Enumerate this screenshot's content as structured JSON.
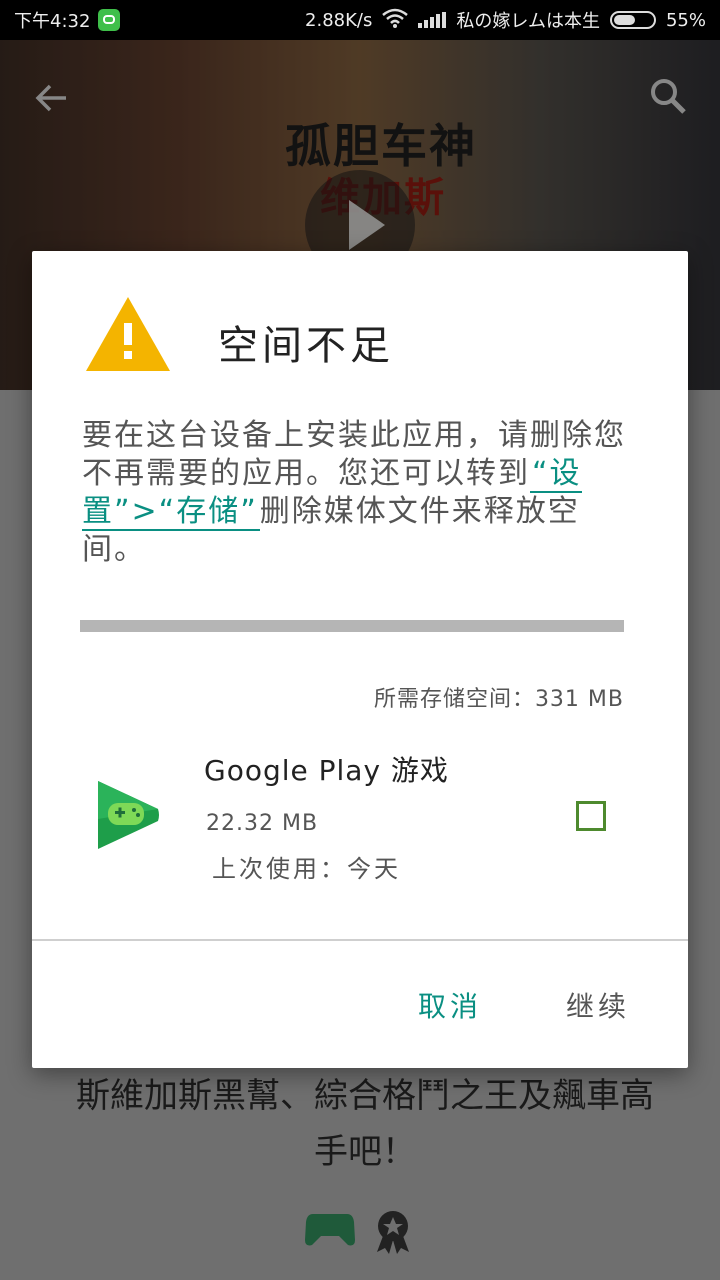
{
  "status_bar": {
    "time": "下午4:32",
    "network_speed": "2.88K/s",
    "carrier": "私の嫁レムは本生",
    "battery": "55%",
    "battery_level": 0.55
  },
  "background": {
    "title_line1": "孤胆车神",
    "title_line2": "维加斯",
    "description": "斯維加斯黑幫、綜合格鬥之王及飆車高手吧！"
  },
  "dialog": {
    "title": "空间不足",
    "message_before": "要在这台设备上安装此应用，请删除您不再需要的应用。您还可以转到",
    "message_link": "“设置”>“存储”",
    "message_after": "删除媒体文件来释放空间。",
    "required_space": "所需存储空间：331 MB",
    "app": {
      "name": "Google Play 游戏",
      "size": "22.32 MB",
      "last_used": "上次使用：今天",
      "checked": false
    },
    "cancel_label": "取消",
    "continue_label": "继续"
  },
  "colors": {
    "accent": "#0a8f82",
    "warning": "#f4b400",
    "checkbox": "#4e8a2e",
    "scrim": "#6f6f6f"
  }
}
